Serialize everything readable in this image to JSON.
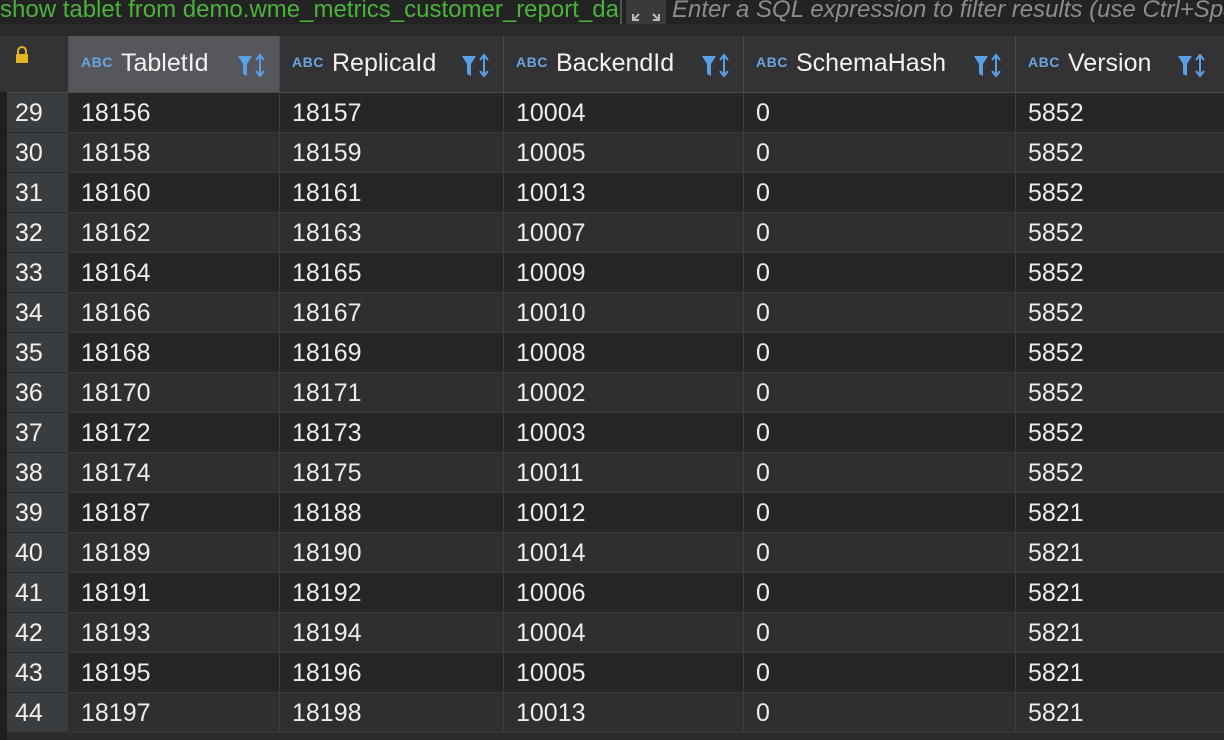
{
  "toolbar": {
    "query_text": "show tablet from demo.wme_metrics_customer_report_daily",
    "filter_placeholder": "Enter a SQL expression to filter results (use Ctrl+Space)"
  },
  "columns": [
    {
      "type": "ABC",
      "name": "TabletId"
    },
    {
      "type": "ABC",
      "name": "ReplicaId"
    },
    {
      "type": "ABC",
      "name": "BackendId"
    },
    {
      "type": "ABC",
      "name": "SchemaHash"
    },
    {
      "type": "ABC",
      "name": "Version"
    }
  ],
  "icons": {
    "lock": "lock-icon",
    "filter_sort": "filter-sort-icon",
    "expand": "expand-icon"
  },
  "colors": {
    "query_text": "#4bb33a",
    "type_badge": "#6aa5e0",
    "lock": "#e6b422",
    "filter_icon": "#5aa0e6"
  },
  "rows": [
    {
      "n": "29",
      "cells": [
        "18156",
        "18157",
        "10004",
        "0",
        "5852"
      ]
    },
    {
      "n": "30",
      "cells": [
        "18158",
        "18159",
        "10005",
        "0",
        "5852"
      ]
    },
    {
      "n": "31",
      "cells": [
        "18160",
        "18161",
        "10013",
        "0",
        "5852"
      ]
    },
    {
      "n": "32",
      "cells": [
        "18162",
        "18163",
        "10007",
        "0",
        "5852"
      ]
    },
    {
      "n": "33",
      "cells": [
        "18164",
        "18165",
        "10009",
        "0",
        "5852"
      ]
    },
    {
      "n": "34",
      "cells": [
        "18166",
        "18167",
        "10010",
        "0",
        "5852"
      ]
    },
    {
      "n": "35",
      "cells": [
        "18168",
        "18169",
        "10008",
        "0",
        "5852"
      ]
    },
    {
      "n": "36",
      "cells": [
        "18170",
        "18171",
        "10002",
        "0",
        "5852"
      ]
    },
    {
      "n": "37",
      "cells": [
        "18172",
        "18173",
        "10003",
        "0",
        "5852"
      ]
    },
    {
      "n": "38",
      "cells": [
        "18174",
        "18175",
        "10011",
        "0",
        "5852"
      ]
    },
    {
      "n": "39",
      "cells": [
        "18187",
        "18188",
        "10012",
        "0",
        "5821"
      ]
    },
    {
      "n": "40",
      "cells": [
        "18189",
        "18190",
        "10014",
        "0",
        "5821"
      ]
    },
    {
      "n": "41",
      "cells": [
        "18191",
        "18192",
        "10006",
        "0",
        "5821"
      ]
    },
    {
      "n": "42",
      "cells": [
        "18193",
        "18194",
        "10004",
        "0",
        "5821"
      ]
    },
    {
      "n": "43",
      "cells": [
        "18195",
        "18196",
        "10005",
        "0",
        "5821"
      ]
    },
    {
      "n": "44",
      "cells": [
        "18197",
        "18198",
        "10013",
        "0",
        "5821"
      ]
    }
  ]
}
